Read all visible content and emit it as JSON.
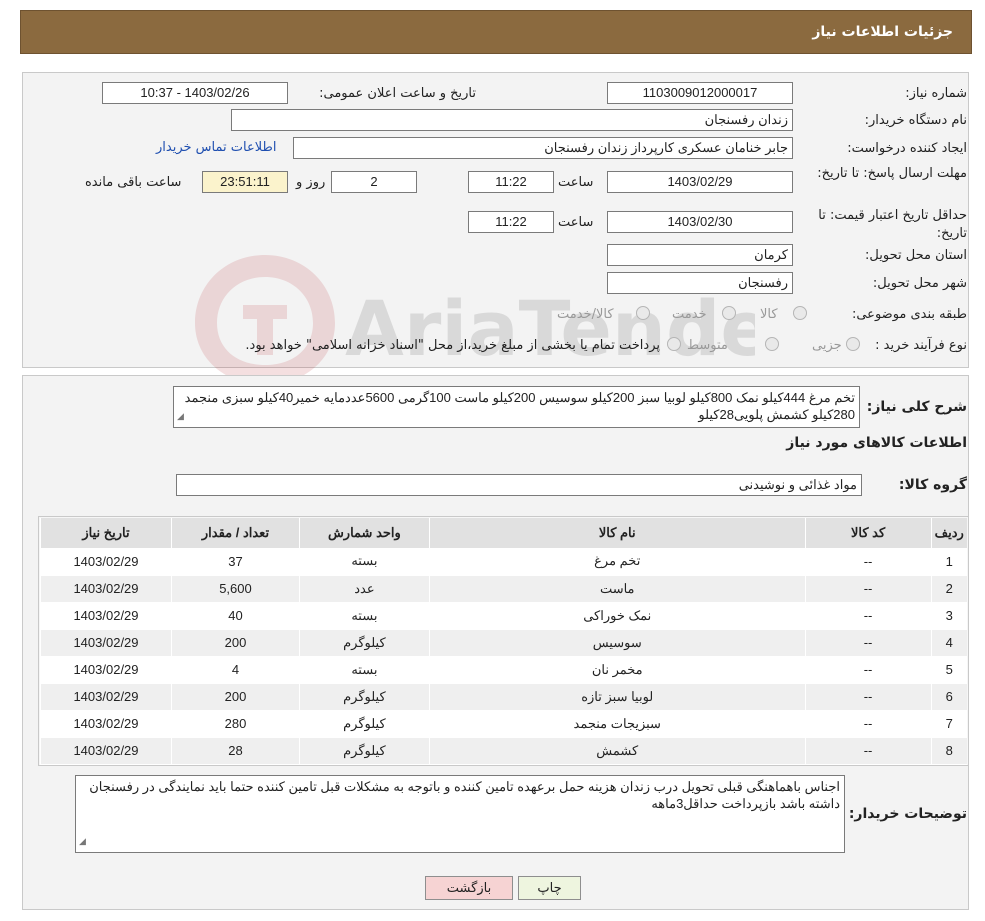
{
  "header": {
    "title": "جزئیات اطلاعات نیاز"
  },
  "labels": {
    "need_number": "شماره نیاز:",
    "announce_datetime": "تاریخ و ساعت اعلان عمومی:",
    "buyer_org": "نام دستگاه خریدار:",
    "requester": "ایجاد کننده درخواست:",
    "contact_link": "اطلاعات تماس خریدار",
    "reply_deadline": "مهلت ارسال پاسخ: تا تاریخ:",
    "time_word": "ساعت",
    "day_word": "روز و",
    "remaining": "ساعت باقی مانده",
    "price_validity": "حداقل تاریخ اعتبار قیمت: تا تاریخ:",
    "province": "استان محل تحویل:",
    "city": "شهر محل تحویل:",
    "category": "طبقه بندی موضوعی:",
    "purchase_type": "نوع فرآیند خرید :",
    "description": "شرح کلی نیاز:",
    "goods_info": "اطلاعات کالاهای مورد نیاز",
    "goods_group": "گروه کالا:",
    "buyer_notes": "توضیحات خریدار:"
  },
  "values": {
    "need_number": "1103009012000017",
    "announce_datetime": "1403/02/26 - 10:37",
    "buyer_org": "زندان رفسنجان",
    "requester": "جابر خنامان عسکری کارپرداز زندان رفسنجان",
    "reply_date": "1403/02/29",
    "reply_time": "11:22",
    "days": "2",
    "remaining_time": "23:51:11",
    "validity_date": "1403/02/30",
    "validity_time": "11:22",
    "province": "کرمان",
    "city": "رفسنجان",
    "description": "تخم مرغ 444کیلو نمک 800کیلو لوبیا سبز 200کیلو سوسیس 200کیلو ماست 100گرمی 5600عددمایه خمیر40کیلو سبزی منجمد 280کیلو کشمش پلویی28کیلو",
    "goods_group": "مواد غذائی و نوشیدنی",
    "buyer_notes": "اجناس باهماهنگی قبلی تحویل درب زندان هزینه حمل برعهده تامین کننده و باتوجه به مشکلات قبل تامین کننده حتما باید نمایندگی در رفسنجان داشته باشد بازپرداخت حداقل3ماهه"
  },
  "category_options": [
    "کالا",
    "خدمت",
    "کالا/خدمت"
  ],
  "purchase_options": [
    "جزیی",
    "متوسط"
  ],
  "purchase_note": "پرداخت تمام یا بخشی از مبلغ خرید،از محل \"اسناد خزانه اسلامی\" خواهد بود.",
  "table": {
    "headers": [
      "ردیف",
      "کد کالا",
      "نام کالا",
      "واحد شمارش",
      "تعداد / مقدار",
      "تاریخ نیاز"
    ],
    "rows": [
      [
        "1",
        "--",
        "تخم مرغ",
        "بسته",
        "37",
        "1403/02/29"
      ],
      [
        "2",
        "--",
        "ماست",
        "عدد",
        "5,600",
        "1403/02/29"
      ],
      [
        "3",
        "--",
        "نمک خوراکی",
        "بسته",
        "40",
        "1403/02/29"
      ],
      [
        "4",
        "--",
        "سوسیس",
        "کیلوگرم",
        "200",
        "1403/02/29"
      ],
      [
        "5",
        "--",
        "مخمر نان",
        "بسته",
        "4",
        "1403/02/29"
      ],
      [
        "6",
        "--",
        "لوبیا سبز تازه",
        "کیلوگرم",
        "200",
        "1403/02/29"
      ],
      [
        "7",
        "--",
        "سبزیجات منجمد",
        "کیلوگرم",
        "280",
        "1403/02/29"
      ],
      [
        "8",
        "--",
        "کشمش",
        "کیلوگرم",
        "28",
        "1403/02/29"
      ]
    ]
  },
  "buttons": {
    "print": "چاپ",
    "back": "بازگشت"
  },
  "watermark": {
    "text": "AriaTender.neT"
  },
  "colors": {
    "header": "#8b6a3f",
    "link": "#1f4fb0",
    "back_button": "#f6d3d3",
    "print_button": "#eef5df"
  }
}
